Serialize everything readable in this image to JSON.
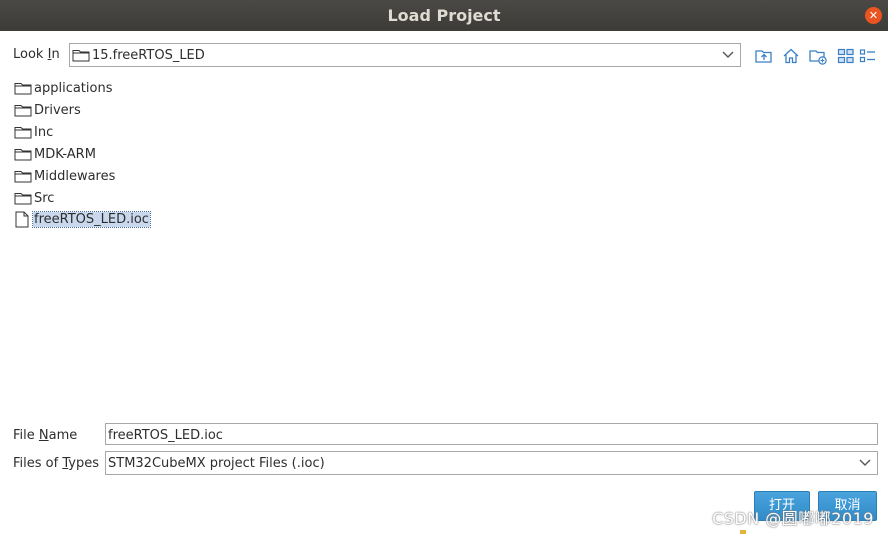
{
  "window": {
    "title": "Load Project"
  },
  "look_in": {
    "label_pre": "Look ",
    "label_mnemonic": "I",
    "label_post": "n",
    "value": "15.freeRTOS_LED"
  },
  "files": [
    {
      "name": "applications",
      "type": "folder"
    },
    {
      "name": "Drivers",
      "type": "folder"
    },
    {
      "name": "Inc",
      "type": "folder"
    },
    {
      "name": "MDK-ARM",
      "type": "folder"
    },
    {
      "name": "Middlewares",
      "type": "folder"
    },
    {
      "name": "Src",
      "type": "folder"
    },
    {
      "name": "freeRTOS_LED.ioc",
      "type": "file",
      "selected": true
    }
  ],
  "file_name": {
    "label_pre": "File ",
    "label_mnemonic": "N",
    "label_post": "ame",
    "value": "freeRTOS_LED.ioc"
  },
  "files_of_type": {
    "label_pre": "Files of ",
    "label_mnemonic": "T",
    "label_post": "ypes",
    "value": "STM32CubeMX project Files (.ioc)"
  },
  "buttons": {
    "open": "打开",
    "cancel": "取消"
  },
  "watermark": "CSDN @圆嘟嘟2019",
  "colors": {
    "titlebar": "#3c3b37",
    "close": "#e95420",
    "button": "#3a97d4",
    "selection": "#c9d8ec",
    "icon": "#3a7fc4"
  },
  "icons": [
    "folder-up-icon",
    "home-icon",
    "new-folder-icon",
    "list-view-icon",
    "details-view-icon"
  ]
}
